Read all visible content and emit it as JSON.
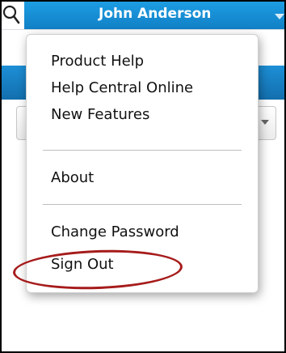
{
  "header": {
    "user_name": "John Anderson",
    "search_icon": "search-icon",
    "user_menu_icon": "chevron-down-icon",
    "accent_color": "#1180c6"
  },
  "dropdown": {
    "items": [
      {
        "label": "Product Help"
      },
      {
        "label": "Help Central Online"
      },
      {
        "label": "New Features"
      },
      {
        "label": "About"
      },
      {
        "label": "Change Password"
      },
      {
        "label": "Sign Out"
      }
    ],
    "highlighted_item": "Sign Out",
    "highlight_color": "#a61b1b"
  }
}
